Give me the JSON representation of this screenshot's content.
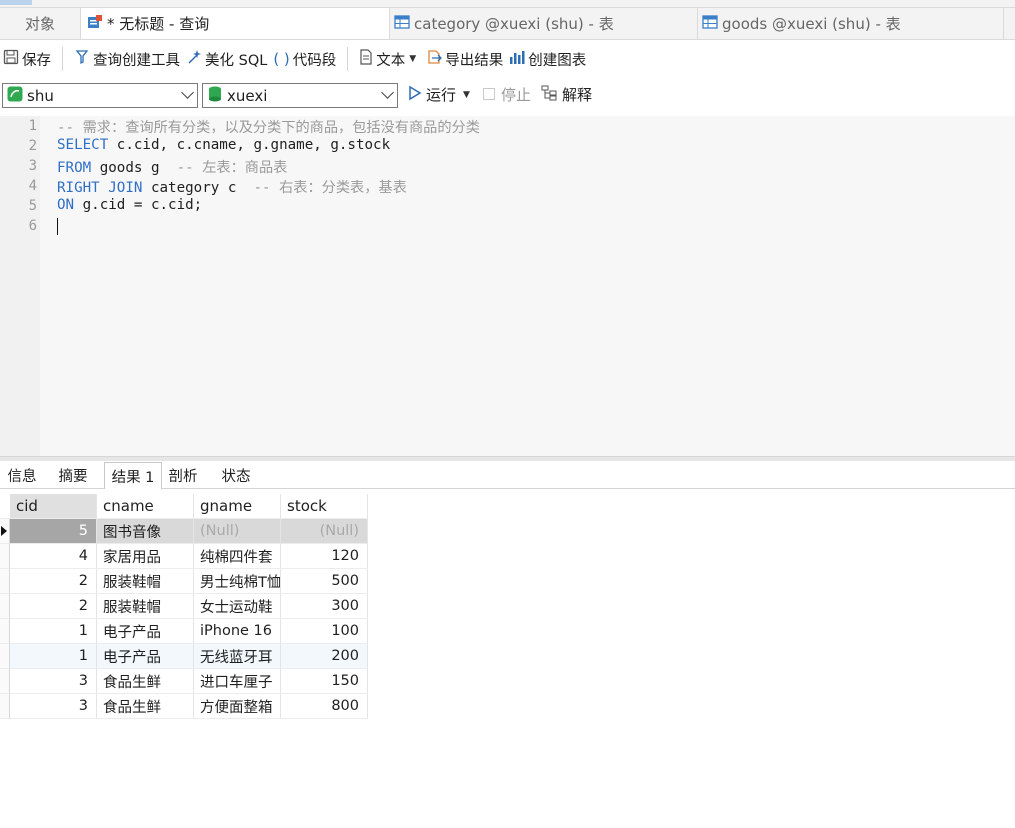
{
  "tabs": {
    "objects": "对象",
    "query": "* 无标题 - 查询",
    "category": "category @xuexi (shu) - 表",
    "goods": "goods @xuexi (shu) - 表"
  },
  "toolbar": {
    "save": "保存",
    "query_builder": "查询创建工具",
    "beautify": "美化 SQL",
    "snippet": "代码段",
    "text": "文本",
    "export": "导出结果",
    "chart": "创建图表"
  },
  "connection": {
    "value": "shu"
  },
  "database": {
    "value": "xuexi"
  },
  "actions": {
    "run": "运行",
    "stop": "停止",
    "explain": "解释"
  },
  "editor": {
    "line_numbers": [
      "1",
      "2",
      "3",
      "4",
      "5",
      "6"
    ],
    "lines": [
      [
        {
          "t": "-- 需求：查询所有分类，以及分类下的商品，包括没有商品的分类",
          "c": "cm"
        }
      ],
      [
        {
          "t": "SELECT",
          "c": "kw"
        },
        {
          "t": " c.cid, c.cname, g.gname, g.stock",
          "c": ""
        }
      ],
      [
        {
          "t": "FROM",
          "c": "kw"
        },
        {
          "t": " goods g  ",
          "c": ""
        },
        {
          "t": "-- 左表：商品表",
          "c": "cm"
        }
      ],
      [
        {
          "t": "RIGHT JOIN",
          "c": "kw"
        },
        {
          "t": " category c  ",
          "c": ""
        },
        {
          "t": "-- 右表：分类表，基表",
          "c": "cm"
        }
      ],
      [
        {
          "t": "ON",
          "c": "kw"
        },
        {
          "t": " g.cid = c.cid;",
          "c": ""
        }
      ],
      []
    ]
  },
  "result_tabs": {
    "info": "信息",
    "summary": "摘要",
    "result1": "结果 1",
    "profile": "剖析",
    "status": "状态"
  },
  "grid": {
    "columns": {
      "cid": "cid",
      "cname": "cname",
      "gname": "gname",
      "stock": "stock"
    },
    "rows": [
      {
        "cid": "5",
        "cname": "图书音像",
        "gname": "(Null)",
        "stock": "(Null)"
      },
      {
        "cid": "4",
        "cname": "家居用品",
        "gname": "纯棉四件套",
        "stock": "120"
      },
      {
        "cid": "2",
        "cname": "服装鞋帽",
        "gname": "男士纯棉T恤",
        "stock": "500"
      },
      {
        "cid": "2",
        "cname": "服装鞋帽",
        "gname": "女士运动鞋",
        "stock": "300"
      },
      {
        "cid": "1",
        "cname": "电子产品",
        "gname": "iPhone 16",
        "stock": "100"
      },
      {
        "cid": "1",
        "cname": "电子产品",
        "gname": "无线蓝牙耳",
        "stock": "200"
      },
      {
        "cid": "3",
        "cname": "食品生鲜",
        "gname": "进口车厘子",
        "stock": "150"
      },
      {
        "cid": "3",
        "cname": "食品生鲜",
        "gname": "方便面整箱",
        "stock": "800"
      }
    ]
  }
}
